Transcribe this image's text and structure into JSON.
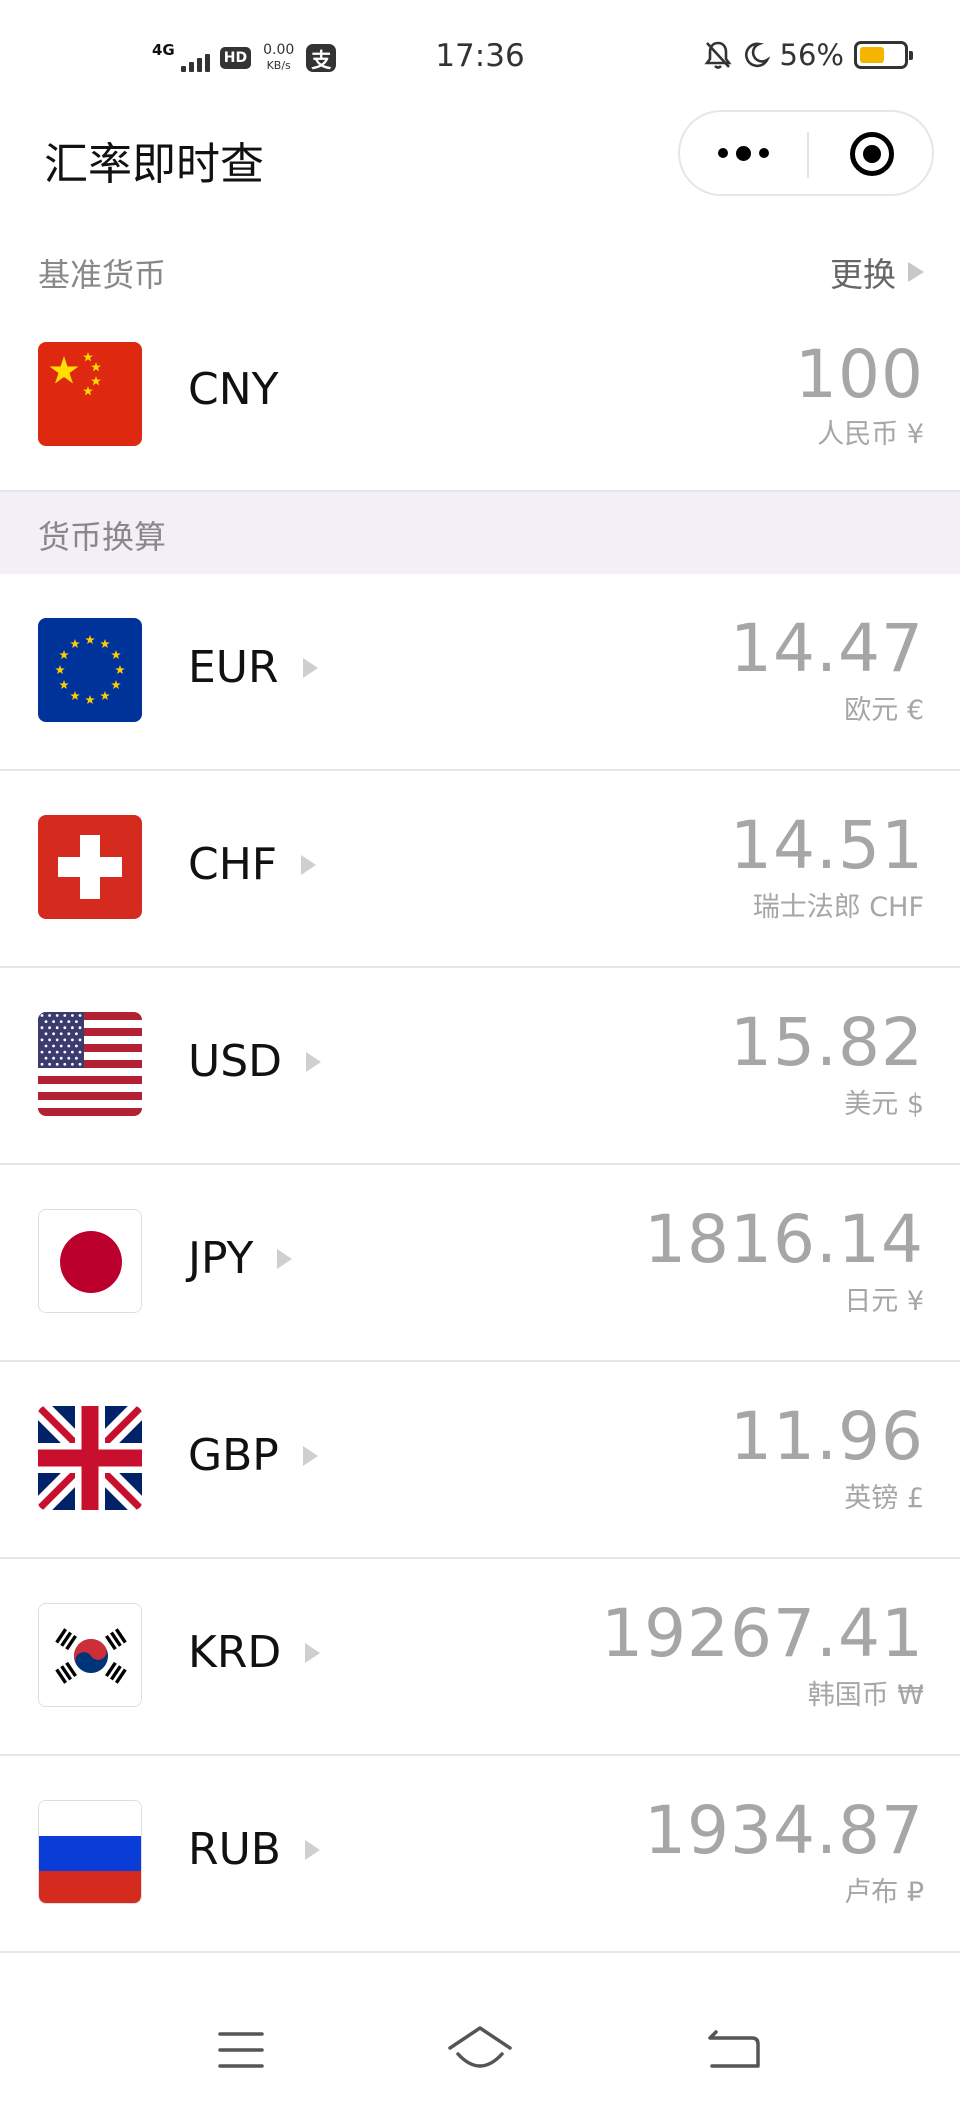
{
  "status_bar": {
    "network": "4G",
    "hd": "HD",
    "speed_value": "0.00",
    "speed_unit": "KB/s",
    "pay_glyph": "支",
    "time": "17:36",
    "battery_percent": "56%",
    "battery_level": 0.56,
    "icons": [
      "signal-icon",
      "hd-icon",
      "pay-icon",
      "mute-bell-icon",
      "moon-icon",
      "battery-icon"
    ]
  },
  "title_bar": {
    "title": "汇率即时查",
    "icons": [
      "more-icon",
      "target-icon"
    ]
  },
  "base": {
    "header": "基准货币",
    "change_label": "更换",
    "code": "CNY",
    "amount": "100",
    "name_symbol": "人民币 ¥",
    "flag": "flag-cn-icon"
  },
  "conversion": {
    "header": "货币换算",
    "rows": [
      {
        "code": "EUR",
        "amount": "14.47",
        "name_symbol": "欧元 €",
        "flag": "flag-eu-icon"
      },
      {
        "code": "CHF",
        "amount": "14.51",
        "name_symbol": "瑞士法郎 CHF",
        "flag": "flag-ch-icon"
      },
      {
        "code": "USD",
        "amount": "15.82",
        "name_symbol": "美元 $",
        "flag": "flag-us-icon"
      },
      {
        "code": "JPY",
        "amount": "1816.14",
        "name_symbol": "日元 ¥",
        "flag": "flag-jp-icon"
      },
      {
        "code": "GBP",
        "amount": "11.96",
        "name_symbol": "英镑 £",
        "flag": "flag-gb-icon"
      },
      {
        "code": "KRD",
        "amount": "19267.41",
        "name_symbol": "韩国币 ₩",
        "flag": "flag-kr-icon"
      },
      {
        "code": "RUB",
        "amount": "1934.87",
        "name_symbol": "卢布 ₽",
        "flag": "flag-ru-icon"
      }
    ]
  },
  "nav_bar": {
    "icons": [
      "menu-icon",
      "home-icon",
      "back-icon"
    ]
  },
  "colors": {
    "section_bg": "#f4eef7",
    "amount_text": "#a6a6a6",
    "battery_fill": "#f4b400"
  }
}
